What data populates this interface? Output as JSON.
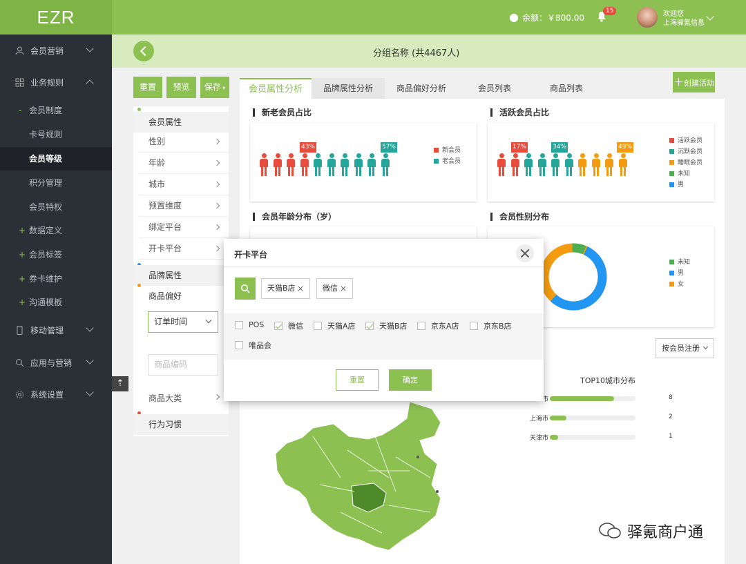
{
  "logo": "EZR",
  "header": {
    "balance_label": "余额：￥800.00",
    "notification_count": "15",
    "welcome_line1": "欢迎您",
    "welcome_line2": "上海驿氪信息"
  },
  "sidebar": {
    "items": [
      {
        "label": "会员营销"
      },
      {
        "label": "业务规则"
      },
      {
        "label": "会员制度"
      },
      {
        "label": "卡号规则"
      },
      {
        "label": "会员等级"
      },
      {
        "label": "积分管理"
      },
      {
        "label": "会员特权"
      },
      {
        "label": "数据定义"
      },
      {
        "label": "会员标签"
      },
      {
        "label": "券卡维护"
      },
      {
        "label": "沟通模板"
      },
      {
        "label": "移动管理"
      },
      {
        "label": "应用与营销"
      },
      {
        "label": "系统设置"
      }
    ]
  },
  "group_title": "分组名称 (共4467人)",
  "toolbar": {
    "reset": "重置",
    "preview": "预览",
    "save": "保存"
  },
  "left_panel": {
    "member_attr": "会员属性",
    "rows": [
      "性别",
      "年龄",
      "城市",
      "预置维度",
      "绑定平台",
      "开卡平台"
    ],
    "brand_attr": "品牌属性",
    "product_pref": "商品偏好",
    "order_time": "订单时间",
    "product_code_placeholder": "商品编码",
    "product_category": "商品大类",
    "behavior": "行为习惯"
  },
  "tabs": [
    "会员属性分析",
    "品牌属性分析",
    "商品偏好分析",
    "会员列表",
    "商品列表"
  ],
  "create_button": "创建活动",
  "cards": {
    "new_old": {
      "title": "新老会员占比",
      "flags": [
        "43%",
        "57%"
      ],
      "legend": [
        "新会员",
        "老会员"
      ]
    },
    "active": {
      "title": "活跃会员占比",
      "flags": [
        "17%",
        "34%",
        "49%"
      ],
      "legend": [
        "活跃会员",
        "沉默会员",
        "睡眠会员",
        "未知",
        "男"
      ]
    },
    "age": {
      "title": "会员年龄分布（岁）"
    },
    "gender": {
      "title": "会员性别分布",
      "legend": [
        "未知",
        "男",
        "女"
      ]
    }
  },
  "map_section": {
    "filter": "按会员注册",
    "top10_title": "TOP10城市分布",
    "cities": [
      {
        "name": "市",
        "value": "8",
        "ratio": 0.75
      },
      {
        "name": "上海市",
        "value": "2",
        "ratio": 0.19
      },
      {
        "name": "天津市",
        "value": "1",
        "ratio": 0.1
      }
    ]
  },
  "modal": {
    "title": "开卡平台",
    "tags": [
      "天猫B店",
      "微信"
    ],
    "options": [
      {
        "label": "POS",
        "checked": false
      },
      {
        "label": "微信",
        "checked": true
      },
      {
        "label": "天猫A店",
        "checked": false
      },
      {
        "label": "天猫B店",
        "checked": true
      },
      {
        "label": "京东A店",
        "checked": false
      },
      {
        "label": "京东B店",
        "checked": false
      },
      {
        "label": "唯品会",
        "checked": false
      }
    ],
    "reset": "重置",
    "confirm": "确定"
  },
  "watermark": "驿氪商户通",
  "colors": {
    "accent": "#8cc152",
    "sidebar": "#2b2f36",
    "red": "#e74c3c",
    "teal": "#26a69a",
    "orange": "#f39c12",
    "blue": "#2196f3",
    "green": "#4caf50"
  }
}
